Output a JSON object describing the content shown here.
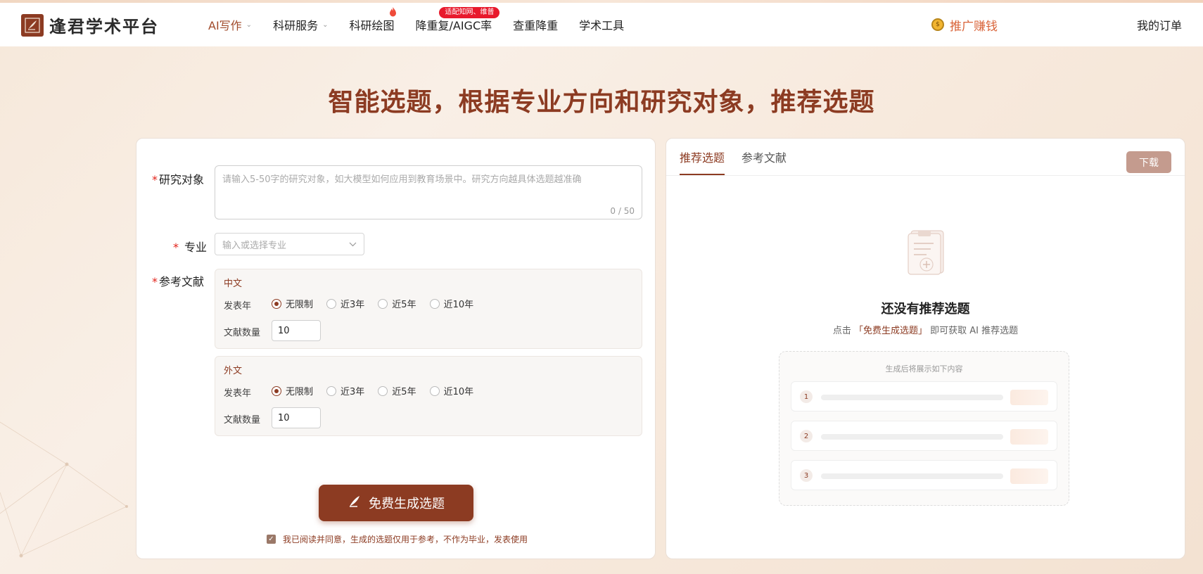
{
  "brand": {
    "name": "逢君学术平台"
  },
  "nav": {
    "items": [
      {
        "label": "AI写作",
        "active": true,
        "has_dropdown": true
      },
      {
        "label": "科研服务",
        "active": false,
        "has_dropdown": true
      },
      {
        "label": "科研绘图",
        "active": false,
        "has_dropdown": false
      },
      {
        "label": "降重复/AIGC率",
        "active": false,
        "has_dropdown": false
      },
      {
        "label": "查重降重",
        "active": false,
        "has_dropdown": false
      },
      {
        "label": "学术工具",
        "active": false,
        "has_dropdown": false
      }
    ],
    "hot_badge": "适配知网、维普",
    "promo_label": "推广赚钱",
    "orders_label": "我的订单"
  },
  "page_title": "智能选题，根据专业方向和研究对象，推荐选题",
  "form": {
    "research_object": {
      "label": "研究对象",
      "placeholder": "请输入5-50字的研究对象，如大模型如何应用到教育场景中。研究方向越具体选题越准确",
      "value": "",
      "counter": "0 / 50"
    },
    "major": {
      "label": "专业",
      "placeholder": "输入或选择专业"
    },
    "references": {
      "label": "参考文献",
      "chinese": {
        "title": "中文",
        "year_label": "发表年",
        "options": [
          "无限制",
          "近3年",
          "近5年",
          "近10年"
        ],
        "selected": "无限制",
        "count_label": "文献数量",
        "count_value": "10"
      },
      "foreign": {
        "title": "外文",
        "year_label": "发表年",
        "options": [
          "无限制",
          "近3年",
          "近5年",
          "近10年"
        ],
        "selected": "无限制",
        "count_label": "文献数量",
        "count_value": "10"
      }
    },
    "generate_button": "免费生成选题",
    "agreement": "我已阅读并同意，生成的选题仅用于参考，不作为毕业，发表使用",
    "agreement_checked": true
  },
  "results": {
    "tabs": [
      {
        "label": "推荐选题",
        "active": true
      },
      {
        "label": "参考文献",
        "active": false
      }
    ],
    "download_label": "下载",
    "empty_title": "还没有推荐选题",
    "hint_prefix": "点击",
    "hint_highlight": "「免费生成选题」",
    "hint_suffix": "即可获取 AI 推荐选题",
    "preview_title": "生成后将展示如下内容",
    "preview_rows": [
      "1",
      "2",
      "3"
    ]
  },
  "colors": {
    "brand": "#8c3b22",
    "accent_orange": "#d9643a",
    "hot_red": "#e8192c",
    "download_btn": "#c49b8e"
  },
  "icons": {
    "logo": "quill-logo-icon",
    "fire": "fire-icon",
    "coin": "coin-icon",
    "generate": "quill-icon",
    "empty": "clipboard-plus-icon"
  }
}
